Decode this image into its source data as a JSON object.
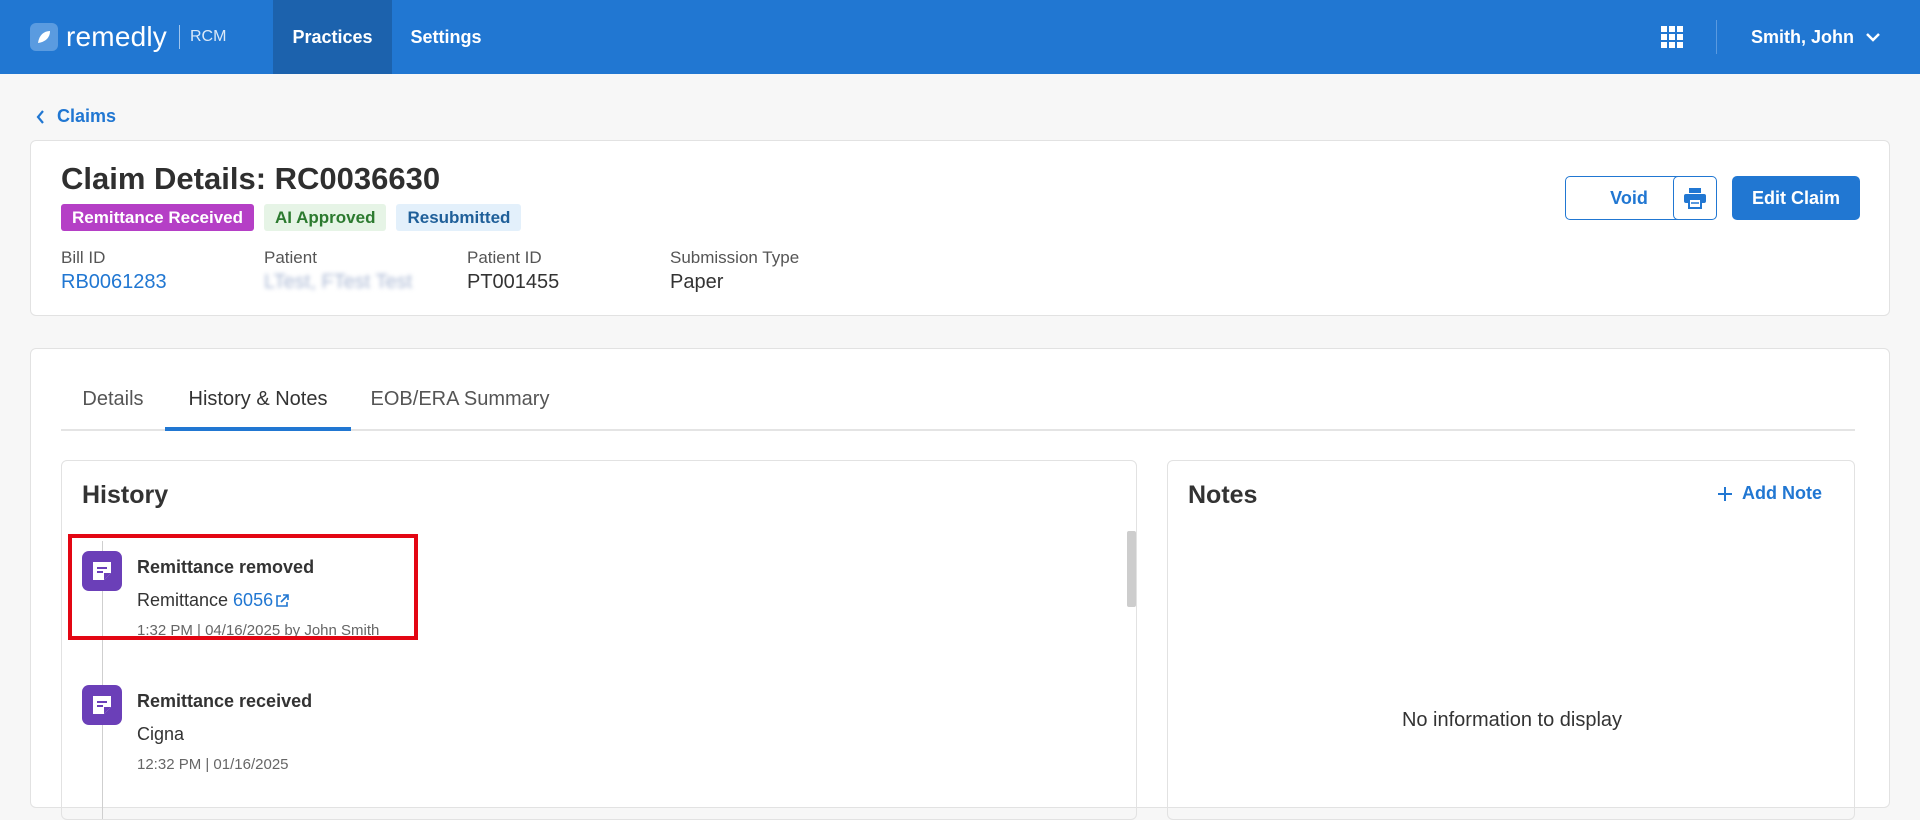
{
  "colors": {
    "primary": "#2177d2",
    "nav_active": "#1c62ad",
    "badge_remittance": "#b53fc6",
    "history_icon": "#6b3fb8",
    "highlight": "#e30613"
  },
  "nav": {
    "logo_text": "remedly",
    "logo_sub": "RCM",
    "items": [
      {
        "label": "Practices",
        "active": true
      },
      {
        "label": "Settings",
        "active": false
      }
    ],
    "apps_icon": "grid-icon",
    "user_name": "Smith, John"
  },
  "breadcrumb": {
    "back_label": "Claims"
  },
  "claim": {
    "title": "Claim Details: RC0036630",
    "badges": [
      "Remittance Received",
      "AI Approved",
      "Resubmitted"
    ],
    "meta": [
      {
        "label": "Bill ID",
        "value": "RB0061283"
      },
      {
        "label": "Patient",
        "value": "LTest, FTest Test"
      },
      {
        "label": "Patient ID",
        "value": "PT001455"
      },
      {
        "label": "Submission Type",
        "value": "Paper"
      }
    ],
    "actions": {
      "void_label": "Void",
      "print_icon": "printer-icon",
      "edit_label": "Edit Claim"
    }
  },
  "tabs": [
    {
      "label": "Details"
    },
    {
      "label": "History & Notes",
      "active": true
    },
    {
      "label": "EOB/ERA Summary"
    }
  ],
  "history": {
    "title": "History",
    "items": [
      {
        "title": "Remittance removed",
        "desc_prefix": "Remittance",
        "link_text": "6056",
        "time": "1:32 PM | 04/16/2025 by John Smith"
      },
      {
        "title": "Remittance received",
        "desc": "Cigna",
        "time": "12:32 PM | 01/16/2025"
      }
    ]
  },
  "notes": {
    "title": "Notes",
    "add_label": "Add Note",
    "empty_message": "No information to display"
  }
}
